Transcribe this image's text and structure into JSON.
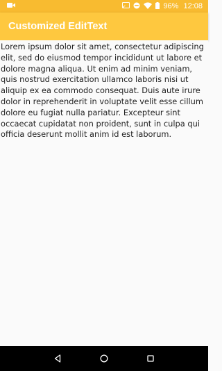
{
  "status_bar": {
    "battery_percent": "96%",
    "time": "12:08",
    "icons": [
      "video-camera-icon",
      "cast-icon",
      "do-not-disturb-icon",
      "wifi-icon",
      "battery-icon"
    ]
  },
  "app_bar": {
    "title": "Customized EditText"
  },
  "editor": {
    "value": "Lorem ipsum dolor sit amet, consectetur adipiscing elit, sed do eiusmod tempor incididunt ut labore et dolore magna aliqua. Ut enim ad minim veniam, quis nostrud exercitation ullamco laboris nisi ut aliquip ex ea commodo consequat. Duis aute irure dolor in reprehenderit in voluptate velit esse cillum dolore eu fugiat nulla pariatur. Excepteur sint occaecat cupidatat non proident, sunt in culpa qui officia deserunt mollit anim id est laborum."
  },
  "nav_bar": {
    "icons": [
      "back-icon",
      "home-icon",
      "recents-icon"
    ]
  },
  "colors": {
    "status_bar": "#f8bb30",
    "app_bar": "#fec83f",
    "background": "#fafafa",
    "nav_bar": "#000000"
  }
}
